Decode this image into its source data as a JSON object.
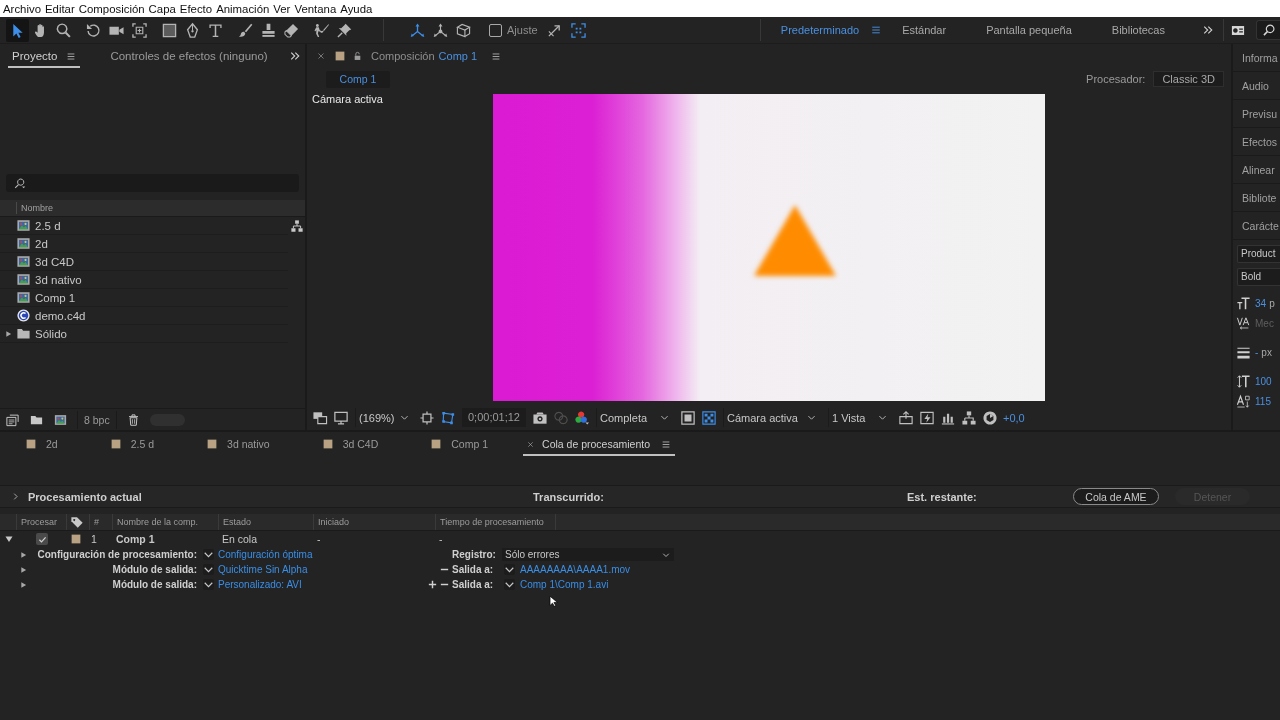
{
  "menu_bar": [
    "Archivo",
    "Editar",
    "Composición",
    "Capa",
    "Efecto",
    "Animación",
    "Ver",
    "Ventana",
    "Ayuda"
  ],
  "toolbar": {
    "tool_groups": [
      [
        {
          "kind": "selection",
          "selected": true
        },
        {
          "kind": "hand",
          "selected": false
        },
        {
          "kind": "zoom",
          "selected": false
        }
      ],
      [
        {
          "kind": "rotation",
          "selected": false
        },
        {
          "kind": "camera",
          "selected": false
        },
        {
          "kind": "pan_behind",
          "selected": false
        }
      ],
      [
        {
          "kind": "shape",
          "selected": false
        },
        {
          "kind": "pen",
          "selected": false
        },
        {
          "kind": "text",
          "selected": false
        }
      ],
      [
        {
          "kind": "brush",
          "selected": false
        },
        {
          "kind": "clone_stamp",
          "selected": false
        },
        {
          "kind": "eraser",
          "selected": false
        }
      ],
      [
        {
          "kind": "roto_brush",
          "selected": false
        },
        {
          "kind": "puppet",
          "selected": false
        }
      ]
    ],
    "axis_modes": [
      {
        "kind": "local",
        "selected": true
      },
      {
        "kind": "world",
        "selected": false
      },
      {
        "kind": "view",
        "selected": false
      }
    ],
    "snapping": {
      "label": "Ajuste",
      "checked": false
    },
    "snap_options": [
      {
        "kind": "edges",
        "on": false
      },
      {
        "kind": "features",
        "on": true
      }
    ]
  },
  "workspaces": [
    {
      "label": "Predeterminado",
      "selected": true
    },
    {
      "label": "Estándar",
      "selected": false
    },
    {
      "label": "Pantalla pequeña",
      "selected": false
    },
    {
      "label": "Bibliotecas",
      "selected": false
    }
  ],
  "project_panel": {
    "tabs": [
      {
        "label": "Proyecto",
        "selected": true
      },
      {
        "label": "Controles de efectos (ninguno)",
        "selected": false
      }
    ],
    "column": "Nombre",
    "items": [
      {
        "name": "2.5 d",
        "kind": "composition"
      },
      {
        "name": "2d",
        "kind": "composition"
      },
      {
        "name": "3d C4D",
        "kind": "composition"
      },
      {
        "name": "3d nativo",
        "kind": "composition"
      },
      {
        "name": "Comp 1",
        "kind": "composition"
      },
      {
        "name": "demo.c4d",
        "kind": "cinema4d_file"
      },
      {
        "name": "Sólido",
        "kind": "folder",
        "expanded": false
      }
    ],
    "bit_depth": "8 bpc"
  },
  "composition_panel": {
    "tab_label": "Composición",
    "tab_name": "Comp 1",
    "view_tabs": [
      {
        "label": "Comp 1",
        "selected": true
      }
    ],
    "renderer_label": "Procesador:",
    "renderer": "Classic 3D",
    "view_label": "Cámara activa",
    "viewer_bar": {
      "zoom": "(169%)",
      "mask_paths": true,
      "timecode": "0;00;01;12",
      "resolution": "Completa",
      "transparency_grid": true,
      "view": "Cámara activa",
      "layout": "1 Vista",
      "exposure": "+0,0"
    }
  },
  "side_panel": {
    "tabs": [
      "Informa",
      "Audio",
      "Previsu",
      "Efectos",
      "Alinear",
      "Bibliote",
      "Carácte"
    ],
    "font": "Product",
    "style": "Bold",
    "rows": [
      {
        "kind": "size",
        "value": "34",
        "unit": "p"
      },
      {
        "kind": "kerning",
        "value": "Mec"
      },
      {
        "kind": "stroke",
        "value": "-",
        "unit": "px"
      },
      {
        "kind": "vertical_scale",
        "value": "100"
      },
      {
        "kind": "baseline",
        "value": "115"
      }
    ]
  },
  "bottom_tabs": [
    {
      "label": "2d",
      "kind": "composition",
      "selected": false
    },
    {
      "label": "2.5 d",
      "kind": "composition",
      "selected": false
    },
    {
      "label": "3d nativo",
      "kind": "composition",
      "selected": false
    },
    {
      "label": "3d C4D",
      "kind": "composition",
      "selected": false
    },
    {
      "label": "Comp 1",
      "kind": "composition",
      "selected": false
    },
    {
      "label": "Cola de procesamiento",
      "kind": "render_queue",
      "selected": true
    }
  ],
  "render_queue": {
    "current": {
      "label": "Procesamiento actual",
      "expanded": false,
      "elapsed_label": "Transcurrido:",
      "remaining_label": "Est. restante:"
    },
    "buttons": [
      {
        "label": "Cola de AME",
        "disabled": false
      },
      {
        "label": "Detener",
        "disabled": true
      }
    ],
    "columns": [
      {
        "kind": "text",
        "label": "Procesar"
      },
      {
        "kind": "label_color"
      },
      {
        "kind": "text",
        "label": "#"
      },
      {
        "kind": "text",
        "label": "Nombre de la comp."
      },
      {
        "kind": "text",
        "label": "Estado"
      },
      {
        "kind": "text",
        "label": "Iniciado"
      },
      {
        "kind": "text",
        "label": "Tiempo de procesamiento"
      }
    ],
    "items": [
      {
        "expanded": true,
        "render": true,
        "number": "1",
        "comp": "Comp 1",
        "status": "En cola",
        "started": "-",
        "render_time": "-",
        "settings": {
          "expanded": false,
          "label": "Configuración de procesamiento:",
          "value": "Configuración óptima",
          "log_label": "Registro:",
          "log": "Sólo errores"
        },
        "outputs": [
          {
            "expanded": false,
            "label": "Módulo de salida:",
            "module": "Quicktime Sin Alpha",
            "can_add": false,
            "output_label": "Salida a:",
            "file": "AAAAAAAA\\AAAA1.mov"
          },
          {
            "expanded": false,
            "label": "Módulo de salida:",
            "module": "Personalizado: AVI",
            "can_add": true,
            "output_label": "Salida a:",
            "file": "Comp 1\\Comp 1.avi"
          }
        ]
      }
    ]
  }
}
